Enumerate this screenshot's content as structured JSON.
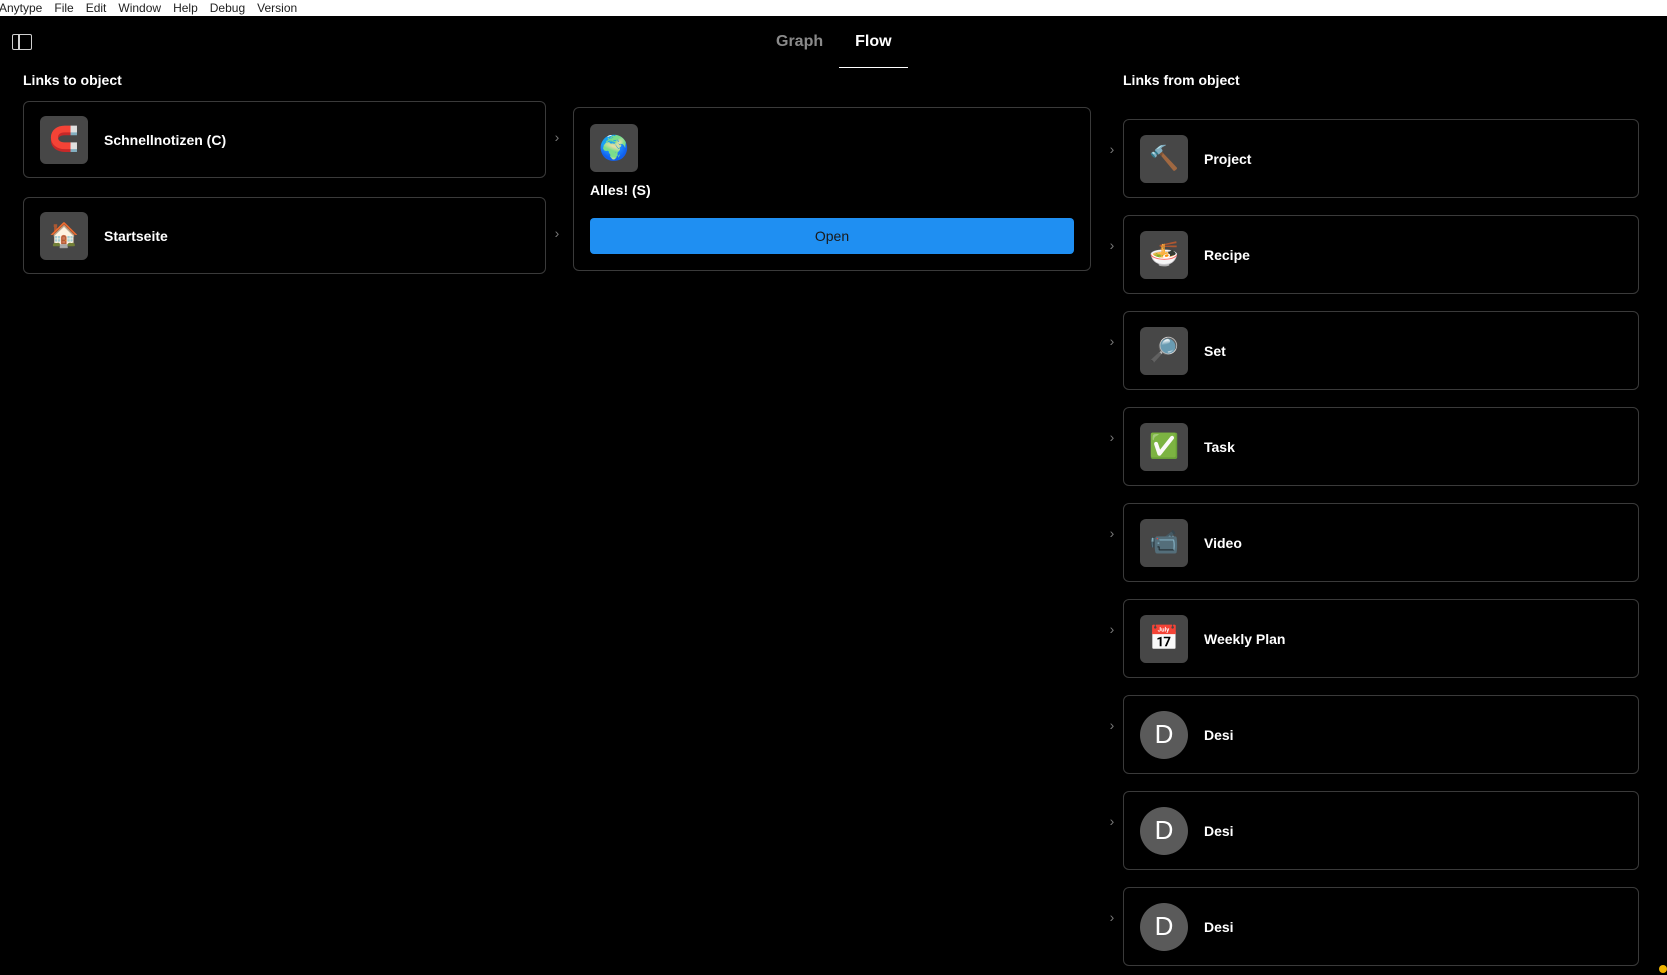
{
  "menubar": {
    "items": [
      "Anytype",
      "File",
      "Edit",
      "Window",
      "Help",
      "Debug",
      "Version"
    ]
  },
  "tabs": [
    {
      "label": "Graph",
      "active": false
    },
    {
      "label": "Flow",
      "active": true
    }
  ],
  "links_to": {
    "title": "Links to object",
    "items": [
      {
        "label": "Schnellnotizen (C)",
        "icon": "magnet-icon",
        "glyph": "🧲"
      },
      {
        "label": "Startseite",
        "icon": "house-icon",
        "glyph": "🏠"
      }
    ]
  },
  "center": {
    "title": "Alles! (S)",
    "icon": "globe-icon",
    "glyph": "🌍",
    "open_label": "Open",
    "accent": "#1f8ff2"
  },
  "links_from": {
    "title": "Links from object",
    "items": [
      {
        "label": "Project",
        "icon": "hammer-icon",
        "glyph": "🔨"
      },
      {
        "label": "Recipe",
        "icon": "bowl-icon",
        "glyph": "🍜"
      },
      {
        "label": "Set",
        "icon": "magnifier-icon",
        "glyph": "🔎"
      },
      {
        "label": "Task",
        "icon": "checkbox-icon",
        "glyph": "✅"
      },
      {
        "label": "Video",
        "icon": "video-camera-icon",
        "glyph": "📹"
      },
      {
        "label": "Weekly Plan",
        "icon": "calendar-icon",
        "glyph": "📅"
      },
      {
        "label": "Desi",
        "icon": "avatar-initial",
        "glyph": "D"
      },
      {
        "label": "Desi",
        "icon": "avatar-initial",
        "glyph": "D"
      },
      {
        "label": "Desi",
        "icon": "avatar-initial",
        "glyph": "D"
      }
    ]
  }
}
